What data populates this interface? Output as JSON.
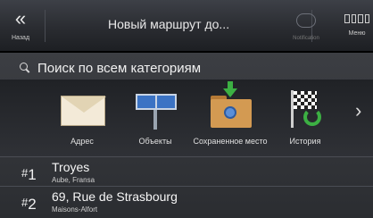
{
  "topbar": {
    "back_label": "Назад",
    "title": "Новый маршрут до...",
    "notifications_label": "Notification",
    "menu_label": "Меню"
  },
  "search": {
    "label": "Поиск по всем категориям"
  },
  "categories": [
    {
      "label": "Адрес",
      "icon": "envelope-icon"
    },
    {
      "label": "Объекты",
      "icon": "poi-signs-icon"
    },
    {
      "label": "Сохраненное место",
      "icon": "saved-place-folder-icon"
    },
    {
      "label": "История",
      "icon": "history-flag-icon"
    }
  ],
  "results": [
    {
      "rank": "1",
      "name": "Troyes",
      "sub": "Aube, Fransa"
    },
    {
      "rank": "2",
      "name": "69, Rue de Strasbourg",
      "sub": "Maisons-Alfort"
    }
  ]
}
